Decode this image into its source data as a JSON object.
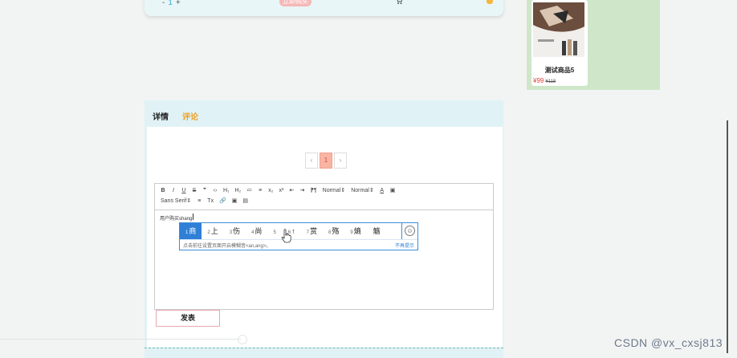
{
  "top_bar": {
    "qty_minus": "-",
    "qty_value": "1",
    "qty_plus": "+",
    "buy_button": "立即购买"
  },
  "recommend": {
    "name": "测试商品5",
    "price": "¥99",
    "old_price": "¥118"
  },
  "tabs": [
    {
      "label": "详情"
    },
    {
      "label": "评论"
    }
  ],
  "pagination": {
    "prev": "‹",
    "current": "1",
    "next": "›"
  },
  "toolbar": {
    "row1": [
      "B",
      "I",
      "U",
      "S",
      "❞",
      "‹›",
      "H₁",
      "H₂",
      "≔",
      "≡",
      "x₂",
      "x²",
      "⇤",
      "⇥",
      "⁋¶"
    ],
    "header_select": "Normal",
    "size_select": "Normal",
    "font_select": "Sans Serif",
    "row2": [
      "≡",
      "Tx",
      "🔗",
      "▣",
      "▤"
    ],
    "color_btn": "A",
    "bg_btn": "▣"
  },
  "editor": {
    "text": "用户购买shang"
  },
  "ime": {
    "candidates": [
      {
        "num": "1",
        "text": "商"
      },
      {
        "num": "2",
        "text": "上"
      },
      {
        "num": "3",
        "text": "伤"
      },
      {
        "num": "4",
        "text": "尚"
      },
      {
        "num": "5",
        "text": ""
      },
      {
        "num": "6",
        "text": "↑"
      },
      {
        "num": "7",
        "text": "赏"
      },
      {
        "num": "8",
        "text": "殇"
      },
      {
        "num": "9",
        "text": "熵"
      },
      {
        "num": "",
        "text": "觞"
      }
    ],
    "hint": "点击前往设置页面开启模糊音<an,ang>。",
    "no_hint": "不再提示",
    "emoji": "☺"
  },
  "publish_button": "发表",
  "watermark": "CSDN @vx_cxsj813",
  "colors": {
    "accent_orange": "#f0a020",
    "price_red": "#e03c3c",
    "ime_blue": "#2f7fd6",
    "panel_bg": "#e0f2f5",
    "recommend_bg": "#cfe6c9"
  }
}
